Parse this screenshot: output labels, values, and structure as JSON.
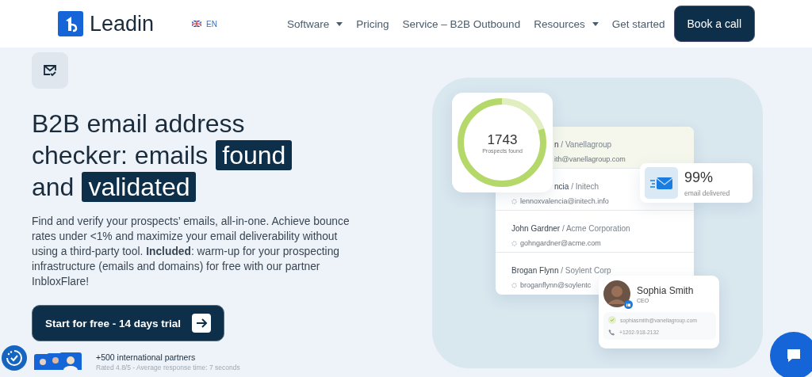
{
  "nav": {
    "logo": "Leadin",
    "language": "EN",
    "items": [
      {
        "label": "Software",
        "dropdown": true
      },
      {
        "label": "Pricing",
        "dropdown": false
      },
      {
        "label": "Service – B2B Outbound",
        "dropdown": false
      },
      {
        "label": "Resources",
        "dropdown": true
      },
      {
        "label": "Get started",
        "dropdown": false
      }
    ],
    "cta": "Book a call"
  },
  "hero": {
    "headline": [
      [
        {
          "text": "B2B email address",
          "highlight": false
        }
      ],
      [
        {
          "text": "checker: emails",
          "highlight": false
        },
        {
          "text": "found",
          "highlight": true
        }
      ],
      [
        {
          "text": "and",
          "highlight": false
        },
        {
          "text": "validated",
          "highlight": true
        }
      ]
    ],
    "description": "Find and verify your prospects’ emails, all-in-one. Achieve bounce rates under <1% and maximize your email deliverability without using a third-party tool. **Included**: warm-up for your prospecting infrastructure (emails and domains) for free with our partner InbloxFlare!",
    "button": "Start for free - 14 days trial",
    "partners_title": "+500 international partners",
    "partners_rating": "Rated 4.8/5 - Average response time: 7 seconds"
  },
  "illustration": {
    "ring": {
      "value": "1743",
      "label": "Prospects found"
    },
    "prospects": [
      {
        "line": "**n** / Vanellagroup",
        "email": "ith@vanellagroup.com",
        "highlighted": true,
        "covered": true,
        "email_covered": true
      },
      {
        "line": "**ncia** / Initech",
        "email": "lennoxvalencia@initech.info",
        "highlighted": false,
        "covered": true,
        "email_covered": false
      },
      {
        "line": "**John Gardner** / Acme Corporation",
        "email": "gohngardner@acme.com",
        "highlighted": false,
        "covered": false,
        "email_covered": false
      },
      {
        "line": "**Brogan Flynn** / Soylent Corp",
        "email": "broganflynn@soylentc",
        "highlighted": false,
        "covered": false,
        "email_covered": false
      }
    ],
    "delivery": {
      "value": "99%",
      "label": "email delivered"
    },
    "contact": {
      "name": "Sophia Smith",
      "role": "CEO",
      "email": "sophiasmith@vanellagroup.com",
      "phone": "+1202-918-2132"
    }
  }
}
